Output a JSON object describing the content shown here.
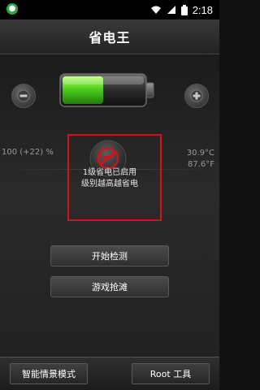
{
  "status_bar": {
    "notification_icon": "green-notification-icon",
    "time": "2:18",
    "icons": [
      "wifi-icon",
      "signal-icon",
      "battery-icon"
    ]
  },
  "header": {
    "title": "省电王"
  },
  "battery": {
    "level_percent": 50,
    "left_stat": "100 (+22) %",
    "temp_c": "30.9°C",
    "temp_f": "87.6°F"
  },
  "power_saving": {
    "line1": "1级省电已启用",
    "line2": "级别越高越省电",
    "icon": "power-saving-icon",
    "accent_color": "#d0141b"
  },
  "buttons": {
    "start_check": "开始检测",
    "game_rush": "游戏抢滩",
    "smart_mode": "智能情景模式",
    "root_tools": "Root 工具"
  },
  "controls": {
    "minus_icon": "minus-icon",
    "plus_icon": "plus-icon"
  }
}
